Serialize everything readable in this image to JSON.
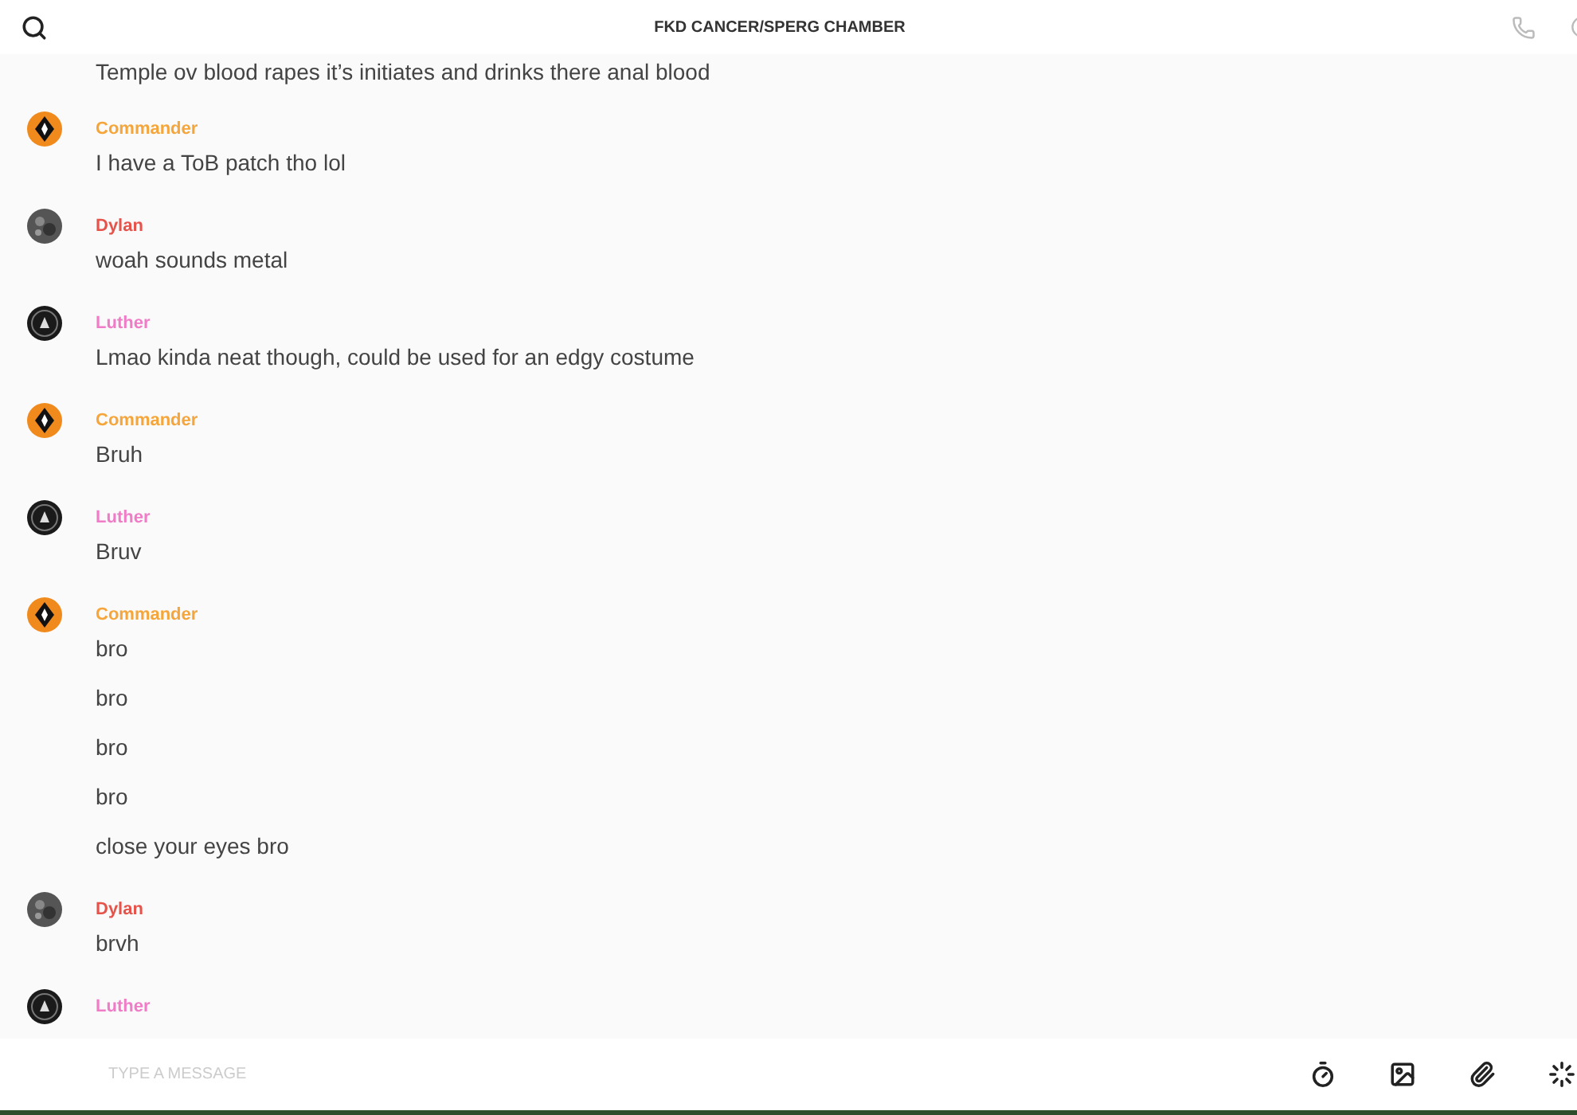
{
  "header": {
    "title": "FKD CANCER/SPERG CHAMBER"
  },
  "messages": [
    {
      "lines": [
        "Temple ov blood rapes it’s initiates and drinks there anal blood"
      ]
    },
    {
      "author": "Commander",
      "color": "#f5a53a",
      "avatar": {
        "kind": "diamond"
      },
      "lines": [
        "I have a ToB patch tho lol"
      ]
    },
    {
      "author": "Dylan",
      "color": "#e5534b",
      "avatar": {
        "kind": "grey"
      },
      "lines": [
        "woah sounds metal"
      ]
    },
    {
      "author": "Luther",
      "color": "#f07cc7",
      "avatar": {
        "kind": "dark"
      },
      "lines": [
        "Lmao kinda neat though, could be used for an edgy costume"
      ]
    },
    {
      "author": "Commander",
      "color": "#f5a53a",
      "avatar": {
        "kind": "diamond"
      },
      "lines": [
        "Bruh"
      ]
    },
    {
      "author": "Luther",
      "color": "#f07cc7",
      "avatar": {
        "kind": "dark"
      },
      "lines": [
        "Bruv"
      ]
    },
    {
      "author": "Commander",
      "color": "#f5a53a",
      "avatar": {
        "kind": "diamond"
      },
      "lines": [
        "bro",
        "bro",
        "bro",
        "bro",
        "close your eyes bro"
      ]
    },
    {
      "author": "Dylan",
      "color": "#e5534b",
      "avatar": {
        "kind": "grey"
      },
      "lines": [
        "brvh"
      ]
    },
    {
      "author": "Luther",
      "color": "#f07cc7",
      "avatar": {
        "kind": "dark"
      }
    }
  ],
  "composer": {
    "placeholder": "TYPE A MESSAGE"
  }
}
